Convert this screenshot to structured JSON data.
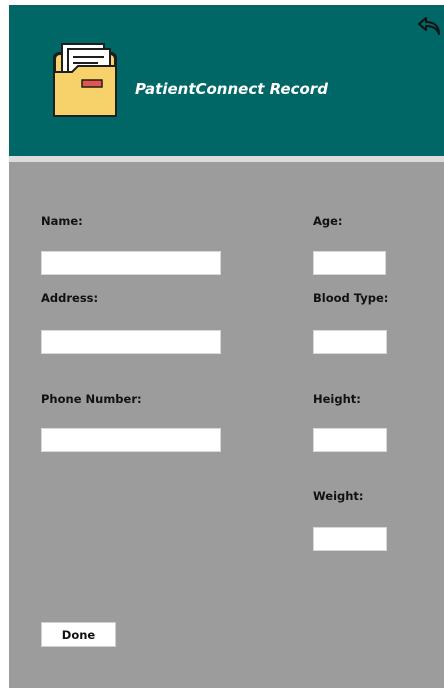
{
  "header": {
    "title": "PatientConnect Record",
    "logo_icon": "folder-documents-icon",
    "back_icon": "back-arrow-icon",
    "background": "#006666"
  },
  "form": {
    "background": "#9c9c9c",
    "name": {
      "label": "Name:",
      "value": ""
    },
    "age": {
      "label": "Age:",
      "value": ""
    },
    "address": {
      "label": "Address:",
      "value": ""
    },
    "blood_type": {
      "label": "Blood Type:",
      "value": ""
    },
    "phone": {
      "label": "Phone Number:",
      "value": ""
    },
    "height": {
      "label": "Height:",
      "value": ""
    },
    "weight": {
      "label": "Weight:",
      "value": ""
    },
    "done_label": "Done"
  }
}
